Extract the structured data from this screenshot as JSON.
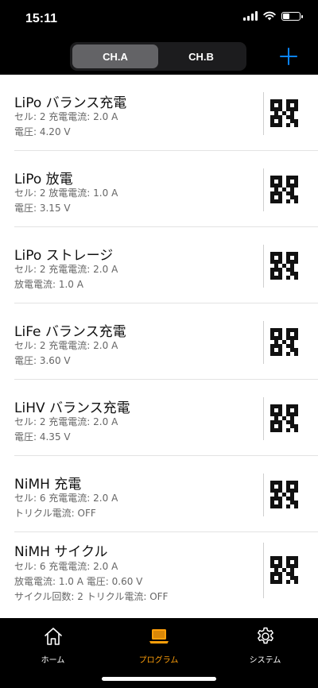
{
  "status_bar": {
    "time": "15:11"
  },
  "header": {
    "segments": [
      {
        "label": "CH.A",
        "selected": true
      },
      {
        "label": "CH.B",
        "selected": false
      }
    ],
    "add_button": "plus-icon"
  },
  "programs": [
    {
      "title": "LiPo  バランス充電",
      "lines": [
        "セル: 2  充電電流: 2.0 A",
        "電圧: 4.20 V"
      ]
    },
    {
      "title": "LiPo  放電",
      "lines": [
        "セル: 2  放電電流: 1.0 A",
        "電圧: 3.15 V"
      ]
    },
    {
      "title": "LiPo  ストレージ",
      "lines": [
        "セル: 2  充電電流: 2.0 A",
        "放電電流: 1.0 A"
      ]
    },
    {
      "title": "LiFe  バランス充電",
      "lines": [
        "セル: 2  充電電流: 2.0 A",
        "電圧: 3.60 V"
      ]
    },
    {
      "title": "LiHV  バランス充電",
      "lines": [
        "セル: 2  充電電流: 2.0 A",
        "電圧: 4.35 V"
      ]
    },
    {
      "title": "NiMH  充電",
      "lines": [
        "セル: 6  充電電流: 2.0 A",
        "トリクル電流: OFF"
      ]
    },
    {
      "title": "NiMH  サイクル",
      "lines": [
        "セル: 6  充電電流: 2.0 A",
        "放電電流: 1.0 A  電圧: 0.60 V",
        "サイクル回数: 2  トリクル電流: OFF"
      ]
    }
  ],
  "tabbar": {
    "tabs": [
      {
        "label": "ホーム",
        "icon": "home-icon",
        "active": false
      },
      {
        "label": "プログラム",
        "icon": "laptop-icon",
        "active": true
      },
      {
        "label": "システム",
        "icon": "gear-icon",
        "active": false
      }
    ]
  },
  "colors": {
    "accent": "#0a84ff",
    "active_tab": "#ff9f0a",
    "list_bg": "#ffffff",
    "chrome_bg": "#000000"
  }
}
